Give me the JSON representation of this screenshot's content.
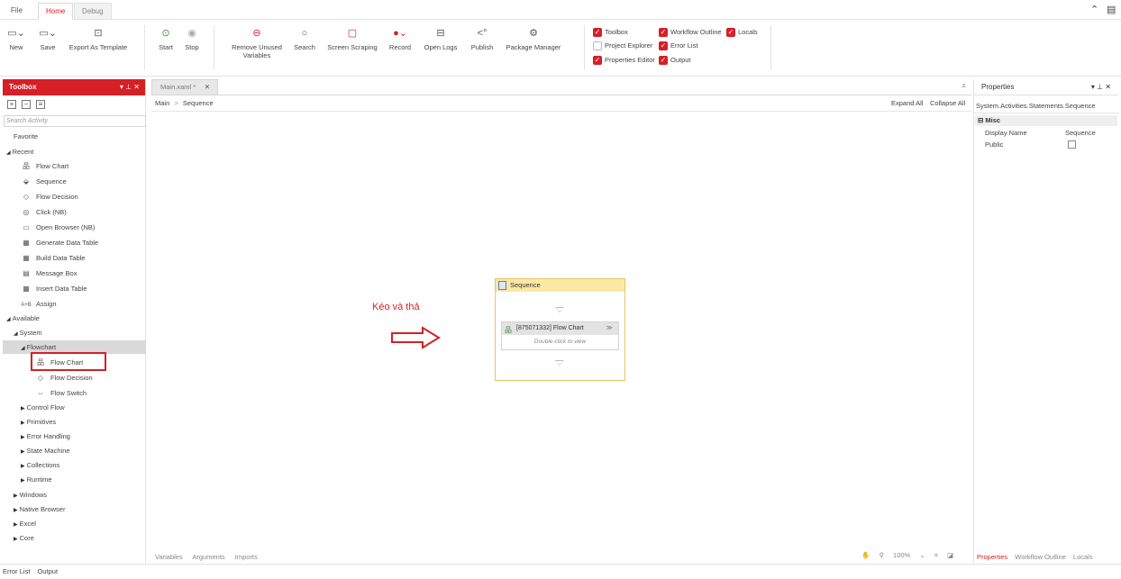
{
  "menu": {
    "tabs": [
      {
        "label": "File"
      },
      {
        "label": "Home"
      },
      {
        "label": "Debug"
      }
    ]
  },
  "ribbon": {
    "new_label": "New",
    "save_label": "Save",
    "export_label": "Export As Template",
    "start_label": "Start",
    "stop_label": "Stop",
    "remove_unused_label_1": "Remove Unused",
    "remove_unused_label_2": "Variables",
    "search_label": "Search",
    "screen_scraping_label": "Screen Scraping",
    "record_label": "Record",
    "open_logs_label": "Open Logs",
    "publish_label": "Publish",
    "package_manager_label": "Package Manager",
    "checks": {
      "toolbox": "Toolbox",
      "workflow_outline": "Workflow Outline",
      "locals": "Locals",
      "project_explorer": "Project Explorer",
      "error_list": "Error List",
      "properties_editor": "Properties Editor",
      "output": "Output"
    }
  },
  "toolbox": {
    "title": "Toolbox",
    "search_placeholder": "Search Activity",
    "favorite": "Favorite",
    "recent": "Recent",
    "recent_items": [
      "Flow Chart",
      "Sequence",
      "Flow Decision",
      "Click (NB)",
      "Open Browser (NB)",
      "Generate Data Table",
      "Build Data Table",
      "Message Box",
      "Insert Data Table",
      "Assign"
    ],
    "available": "Available",
    "system": "System",
    "flowchart_group": "Flowchart",
    "flowchart_items": [
      "Flow Chart",
      "Flow Decision",
      "Flow Switch"
    ],
    "system_groups": [
      "Control Flow",
      "Primitives",
      "Error Handling",
      "State Machine",
      "Collections",
      "Runtime"
    ],
    "other_groups": [
      "Windows",
      "Native Browser",
      "Excel",
      "Core"
    ]
  },
  "document": {
    "tab_label": "Main.xaml *",
    "breadcrumb_root": "Main",
    "breadcrumb_current": "Sequence",
    "expand_all": "Expand All",
    "collapse_all": "Collapse All",
    "sequence_title": "Sequence",
    "flowchart_title": "[875071332] Flow Chart",
    "flowchart_hint": "Double-click to view",
    "annotation": "Kéo và thả",
    "bottom_tabs": [
      "Variables",
      "Arguments",
      "Imports"
    ],
    "zoom_level": "100%"
  },
  "properties": {
    "title": "Properties",
    "type_name": "System.Activities.Statements.Sequence",
    "category": "Misc",
    "rows": [
      {
        "name": "Display Name",
        "value": "Sequence"
      },
      {
        "name": "Public",
        "value": ""
      }
    ],
    "public_checked": false,
    "tabs": [
      "Properties",
      "Workflow Outline",
      "Locals"
    ]
  },
  "status": {
    "error_list": "Error List",
    "output": "Output"
  },
  "colors": {
    "accent": "#d61f26",
    "sequence_header": "#fce8a6",
    "sequence_border": "#e6c463"
  }
}
